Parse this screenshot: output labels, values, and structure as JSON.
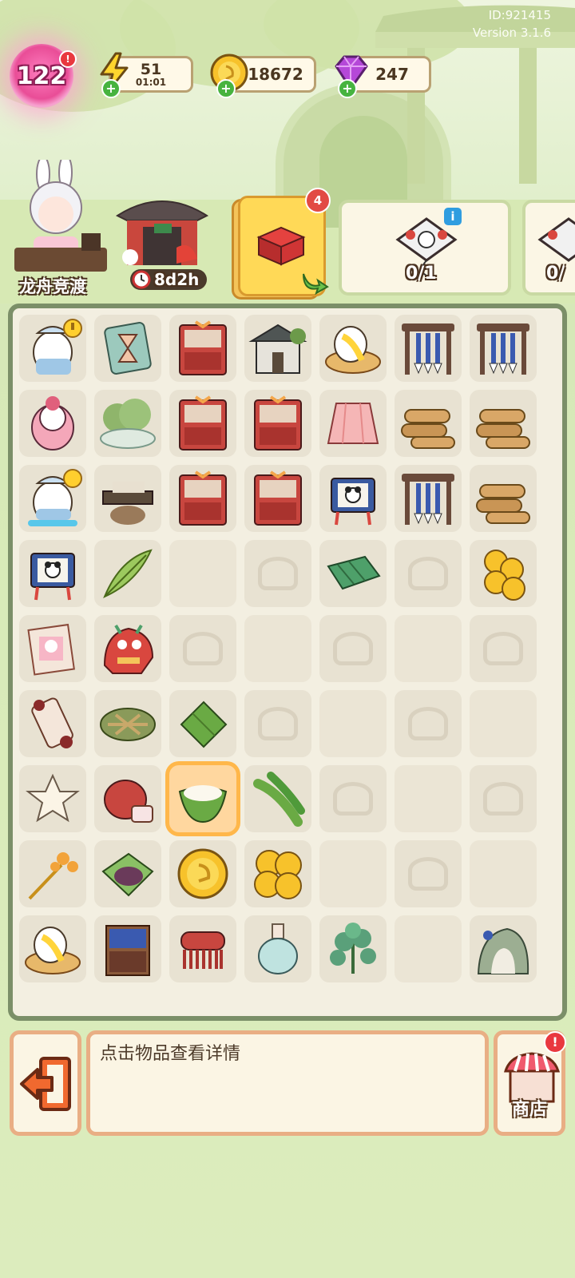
{
  "meta": {
    "id_text": "ID:921415",
    "version_text": "Version 3.1.6"
  },
  "hud": {
    "level": "122",
    "energy": {
      "value": "51",
      "timer": "01:01"
    },
    "coins": "18672",
    "gems": "247"
  },
  "event": {
    "name": "龙舟竞渡"
  },
  "shop_timer": "8d2h",
  "gift_badge": "4",
  "tasks": [
    {
      "progress": "0/1"
    },
    {
      "progress": "0/"
    }
  ],
  "board": {
    "rows": [
      [
        "duck-courier",
        "hourglass-scroll",
        "red-cabinet",
        "stone-house",
        "duck-drum",
        "brush-rack",
        "brush-rack"
      ],
      [
        "duck-grandma",
        "tree-cloud",
        "red-cabinet",
        "red-cabinet",
        "pink-skirt",
        "log-pile",
        "log-pile"
      ],
      [
        "duck-courier-b",
        "ink-desk",
        "red-cabinet",
        "red-cabinet",
        "panda-scroll",
        "brush-rack",
        "log-pile"
      ],
      [
        "panda-scroll",
        "bamboo-leaf",
        "blank",
        "empty",
        "leaf-bundle",
        "empty",
        "coin-stack"
      ],
      [
        "duck-scroll",
        "dragon-head",
        "empty",
        "blank",
        "empty",
        "blank",
        "empty"
      ],
      [
        "paper-roll",
        "leaf-tray",
        "zongzi",
        "empty",
        "blank",
        "empty",
        "blank"
      ],
      [
        "dough-star",
        "rice-sack",
        "zongzi-bowl",
        "reed-leaves",
        "empty",
        "blank",
        "empty"
      ],
      [
        "hairpin",
        "bean-zongzi",
        "coin",
        "coin-pile",
        "blank",
        "empty",
        "blank"
      ],
      [
        "duck-drum",
        "bookshelf",
        "comb",
        "vase",
        "herb",
        "blank",
        "stone-cave"
      ]
    ],
    "selected": [
      6,
      2
    ]
  },
  "info_text": "点击物品查看详情",
  "store_label": "商店",
  "colors": {
    "panel_border": "#e9ae84",
    "board_border": "#7b8f68",
    "accent_red": "#e9383f",
    "accent_green": "#47b33f"
  }
}
